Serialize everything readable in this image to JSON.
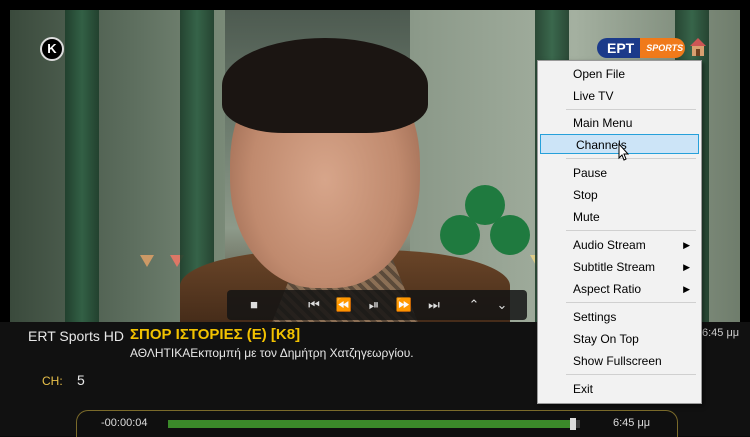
{
  "channel_logo": {
    "brand": "ΕΡΤ",
    "sub": "SPORTS"
  },
  "player_logo": {
    "letter": "K"
  },
  "info_bar": {
    "channel_name": "ERT Sports HD",
    "program_title": "ΣΠΟΡ ΙΣΤΟΡΙΕΣ (Ε) [Κ8]",
    "program_desc": "ΑΘΛΗΤΙΚΑΕκπομπή με τον Δημήτρη Χατζηγεωργίου.",
    "ch_label": "CH:",
    "ch_value": "5",
    "time_right": "6:45 μμ"
  },
  "seek": {
    "elapsed": "-00:00:04",
    "end_time": "6:45 μμ",
    "progress": 0.975
  },
  "controls": [
    "stop-icon",
    "prev-icon",
    "rewind-icon",
    "play-pause-icon",
    "forward-icon",
    "next-icon",
    "up-icon",
    "down-icon"
  ],
  "context_menu": {
    "items": [
      {
        "label": "Open File"
      },
      {
        "label": "Live TV"
      },
      {
        "label": "Main Menu"
      },
      {
        "label": "Channels"
      },
      {
        "label": "Pause"
      },
      {
        "label": "Stop"
      },
      {
        "label": "Mute"
      },
      {
        "label": "Audio Stream"
      },
      {
        "label": "Subtitle Stream"
      },
      {
        "label": "Aspect Ratio"
      },
      {
        "label": "Settings"
      },
      {
        "label": "Stay On Top"
      },
      {
        "label": "Show Fullscreen"
      },
      {
        "label": "Exit"
      }
    ],
    "highlighted": "Channels",
    "submenu_items": [
      "Audio Stream",
      "Subtitle Stream",
      "Aspect Ratio"
    ]
  },
  "colors": {
    "title_yellow": "#f2c200",
    "seek_green": "#3b8a2a",
    "menu_highlight": "#cce4f7"
  }
}
